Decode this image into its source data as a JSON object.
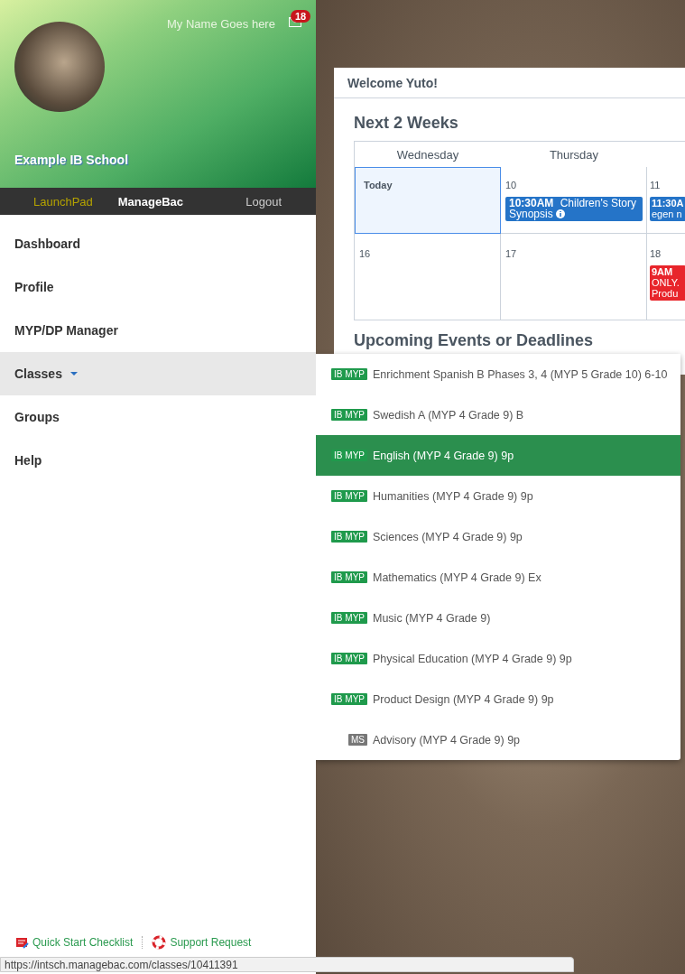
{
  "header": {
    "user_name": "My Name Goes here",
    "mail_count": "18",
    "school": "Example IB School"
  },
  "top_nav": [
    {
      "label": "LaunchPad",
      "selected": false,
      "color": "#b5a300"
    },
    {
      "label": "ManageBac",
      "selected": true,
      "color": "#ffffff"
    },
    {
      "label": "Logout",
      "selected": false,
      "color": "#cccccc"
    }
  ],
  "sidebar": {
    "items": [
      {
        "label": "Dashboard",
        "selected": false,
        "expanded": false
      },
      {
        "label": "Profile",
        "selected": false,
        "expanded": false
      },
      {
        "label": "MYP/DP Manager",
        "selected": false,
        "expanded": false
      },
      {
        "label": "Classes",
        "selected": true,
        "expanded": true
      },
      {
        "label": "Groups",
        "selected": false,
        "expanded": false
      },
      {
        "label": "Help",
        "selected": false,
        "expanded": false
      }
    ]
  },
  "footer_links": [
    {
      "label": "Quick Start Checklist",
      "kind": "checklist"
    },
    {
      "label": "Support Request",
      "kind": "support"
    }
  ],
  "card": {
    "title": "Welcome Yuto!",
    "section_title": "Next 2 Weeks",
    "upcoming_title": "Upcoming Events or Deadlines",
    "calendar": {
      "columns": [
        "Wednesday",
        "Thursday"
      ],
      "rows": [
        [
          {
            "day": "Today",
            "today": true
          },
          {
            "day": "10",
            "today": false,
            "events": [
              {
                "time": "10:30AM",
                "title": "Children's Story Synopsis",
                "color": "#2574c8",
                "info": true
              }
            ]
          },
          {
            "day": "11",
            "today": false,
            "events": [
              {
                "time": "11:30A",
                "title": "egen n",
                "color": "#2574c8",
                "info": false
              }
            ]
          }
        ],
        [
          {
            "day": "16",
            "today": false
          },
          {
            "day": "17",
            "today": false
          },
          {
            "day": "18",
            "today": false,
            "events": [
              {
                "time": "9AM",
                "title": "ONLY. Produ",
                "color": "#e8252b",
                "info": false
              }
            ]
          }
        ]
      ]
    }
  },
  "classes_menu": [
    {
      "badge": "IB MYP",
      "color": "#1f9a4c",
      "label": "Enrichment Spanish B Phases 3, 4 (MYP 5 Grade 10) 6-10",
      "selected": false
    },
    {
      "badge": "IB MYP",
      "color": "#1f9a4c",
      "label": "Swedish A (MYP 4 Grade 9) B",
      "selected": false
    },
    {
      "badge": "IB MYP",
      "color": "#1f9a4c",
      "label": "English (MYP 4 Grade 9) 9p",
      "selected": true
    },
    {
      "badge": "IB MYP",
      "color": "#1f9a4c",
      "label": "Humanities (MYP 4 Grade 9) 9p",
      "selected": false
    },
    {
      "badge": "IB MYP",
      "color": "#1f9a4c",
      "label": "Sciences (MYP 4 Grade 9) 9p",
      "selected": false
    },
    {
      "badge": "IB MYP",
      "color": "#1f9a4c",
      "label": "Mathematics (MYP 4 Grade 9) Ex",
      "selected": false
    },
    {
      "badge": "IB MYP",
      "color": "#1f9a4c",
      "label": "Music (MYP 4 Grade 9)",
      "selected": false
    },
    {
      "badge": "IB MYP",
      "color": "#1f9a4c",
      "label": "Physical Education (MYP 4 Grade 9) 9p",
      "selected": false
    },
    {
      "badge": "IB MYP",
      "color": "#1f9a4c",
      "label": "Product Design (MYP 4 Grade 9) 9p",
      "selected": false
    },
    {
      "badge": "MS",
      "color": "#777777",
      "label": "Advisory (MYP 4 Grade 9) 9p",
      "selected": false
    }
  ],
  "status_bar": {
    "url": "https://intsch.managebac.com/classes/10411391"
  }
}
